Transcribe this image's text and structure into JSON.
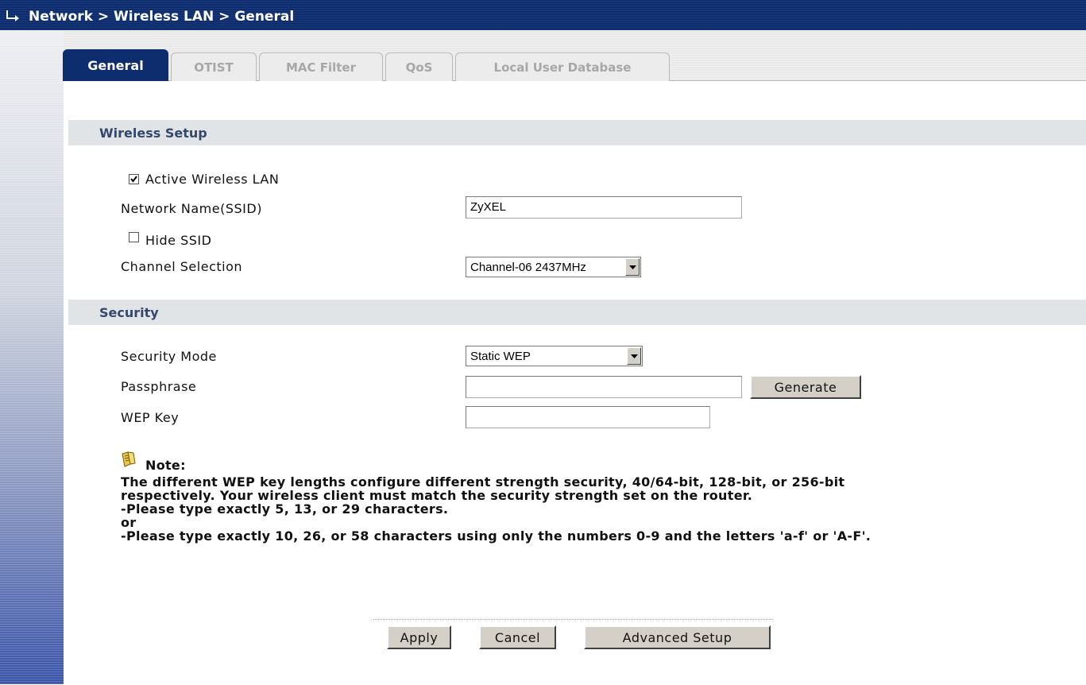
{
  "breadcrumb": "Network > Wireless LAN > General",
  "tabs": [
    {
      "label": "General",
      "active": true
    },
    {
      "label": "OTIST",
      "active": false
    },
    {
      "label": "MAC Filter",
      "active": false
    },
    {
      "label": "QoS",
      "active": false
    },
    {
      "label": "Local User Database",
      "active": false
    }
  ],
  "wireless_setup": {
    "header": "Wireless Setup",
    "active_wlan_label": "Active Wireless LAN",
    "active_wlan_checked": true,
    "ssid_label": "Network Name(SSID)",
    "ssid_value": "ZyXEL",
    "hide_ssid_label": "Hide SSID",
    "hide_ssid_checked": false,
    "channel_label": "Channel Selection",
    "channel_value": "Channel-06 2437MHz"
  },
  "security": {
    "header": "Security",
    "mode_label": "Security Mode",
    "mode_value": "Static WEP",
    "passphrase_label": "Passphrase",
    "passphrase_value": "",
    "generate_label": "Generate",
    "wep_key_label": "WEP Key",
    "wep_key_value": ""
  },
  "note": {
    "title": "Note:",
    "lines": [
      "The different WEP key lengths configure different strength security, 40/64-bit, 128-bit, or 256-bit",
      "respectively. Your wireless client must match the security strength set on the router.",
      "-Please type exactly 5, 13, or 29 characters.",
      "or",
      "-Please type exactly 10, 26, or 58 characters using only the numbers 0-9 and the letters 'a-f' or 'A-F'."
    ]
  },
  "buttons": {
    "apply": "Apply",
    "cancel": "Cancel",
    "advanced": "Advanced Setup"
  },
  "colors": {
    "title_bar": "#0d2d6e",
    "active_tab": "#0d2d6e",
    "section_bg": "#e0e4e6",
    "section_text": "#33486b"
  }
}
